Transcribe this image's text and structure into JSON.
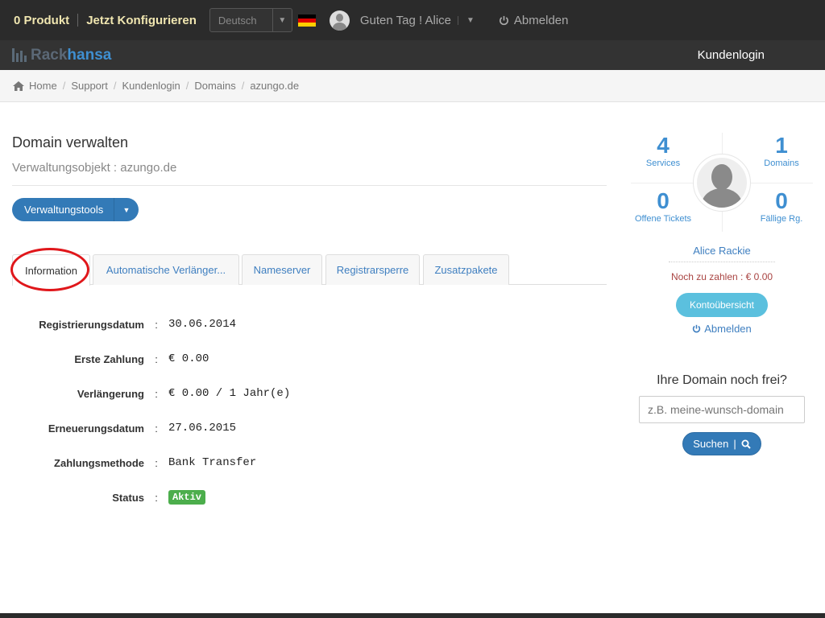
{
  "topbar": {
    "cart_label": "0 Produkt",
    "configure_label": "Jetzt Konfigurieren",
    "language": "Deutsch",
    "greeting": "Guten Tag ! Alice",
    "logout_label": "Abmelden"
  },
  "brand": {
    "part1": "Rack",
    "part2": "hansa",
    "nav_login": "Kundenlogin"
  },
  "breadcrumb": [
    "Home",
    "Support",
    "Kundenlogin",
    "Domains",
    "azungo.de"
  ],
  "page": {
    "title": "Domain verwalten",
    "subtitle": "Verwaltungsobjekt : azungo.de",
    "tools_button": "Verwaltungstools"
  },
  "tabs": [
    "Information",
    "Automatische Verlänger...",
    "Nameserver",
    "Registrarsperre",
    "Zusatzpakete"
  ],
  "details": [
    {
      "label": "Registrierungsdatum",
      "value": "30.06.2014"
    },
    {
      "label": "Erste Zahlung",
      "value": "€ 0.00"
    },
    {
      "label": "Verlängerung",
      "value": "€ 0.00 / 1 Jahr(e)"
    },
    {
      "label": "Erneuerungsdatum",
      "value": "27.06.2015"
    },
    {
      "label": "Zahlungsmethode",
      "value": "Bank Transfer"
    },
    {
      "label": "Status",
      "value": "Aktiv"
    }
  ],
  "stats": {
    "services": {
      "count": "4",
      "label": "Services"
    },
    "domains": {
      "count": "1",
      "label": "Domains"
    },
    "tickets": {
      "count": "0",
      "label": "Offene Tickets"
    },
    "invoices": {
      "count": "0",
      "label": "Fällige Rg."
    }
  },
  "account": {
    "name": "Alice Rackie",
    "due": "Noch zu zahlen : € 0.00",
    "overview_button": "Kontoübersicht",
    "logout": "Abmelden"
  },
  "domain_search": {
    "question": "Ihre Domain noch frei?",
    "placeholder": "z.B. meine-wunsch-domain",
    "button": "Suchen"
  },
  "colors": {
    "accent": "#337ab7",
    "link": "#3f8fd1",
    "status_active": "#4cae4c",
    "annotation": "#e0171b"
  }
}
